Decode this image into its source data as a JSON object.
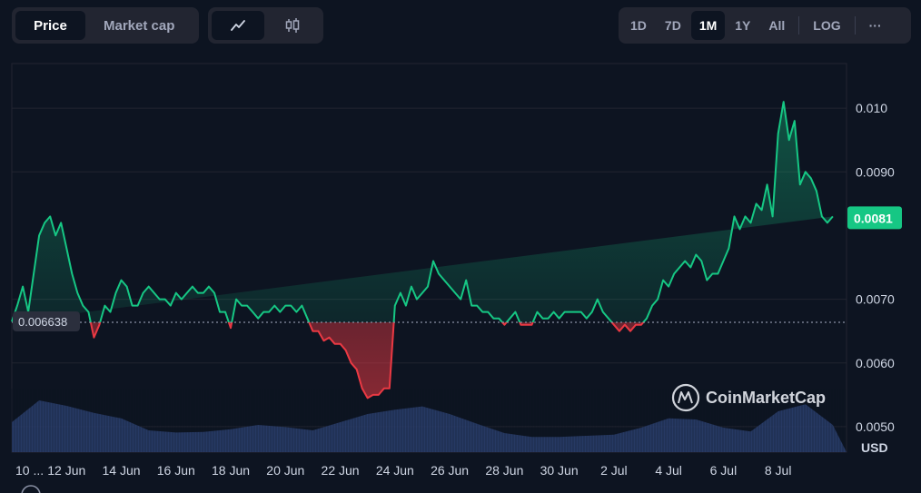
{
  "toolbar": {
    "type_tabs": [
      {
        "label": "Price",
        "active": true
      },
      {
        "label": "Market cap",
        "active": false
      }
    ],
    "style_tabs": [
      {
        "icon": "line-chart-icon",
        "active": true
      },
      {
        "icon": "candlestick-icon",
        "active": false
      }
    ],
    "range_tabs": [
      {
        "label": "1D",
        "active": false
      },
      {
        "label": "7D",
        "active": false
      },
      {
        "label": "1M",
        "active": true
      },
      {
        "label": "1Y",
        "active": false
      },
      {
        "label": "All",
        "active": false
      },
      {
        "label": "LOG",
        "active": false
      }
    ],
    "more_label": "···"
  },
  "watermark": "CoinMarketCap",
  "colors": {
    "background": "#0d1421",
    "up": "#16c784",
    "down": "#ea3943",
    "volume": "#2c3f6e",
    "grid": "#222531",
    "current_label_bg": "#16c784"
  },
  "chart_data": {
    "type": "area",
    "title": "",
    "xlabel": "",
    "ylabel": "",
    "currency_label": "USD",
    "baseline_label": "0.006638",
    "current_label": "0.0081",
    "baseline": 0.006638,
    "ylim": [
      0.0046,
      0.0107
    ],
    "y_ticks": [
      {
        "value": 0.005,
        "label": "0.0050"
      },
      {
        "value": 0.006,
        "label": "0.0060"
      },
      {
        "value": 0.007,
        "label": "0.0070"
      },
      {
        "value": 0.009,
        "label": "0.0090"
      },
      {
        "value": 0.01,
        "label": "0.010"
      }
    ],
    "x_range": [
      10,
      40.5
    ],
    "x_ticks": [
      {
        "day": 10.0,
        "label": "10 ..."
      },
      {
        "day": 12.0,
        "label": "12 Jun"
      },
      {
        "day": 14.0,
        "label": "14 Jun"
      },
      {
        "day": 16.0,
        "label": "16 Jun"
      },
      {
        "day": 18.0,
        "label": "18 Jun"
      },
      {
        "day": 20.0,
        "label": "20 Jun"
      },
      {
        "day": 22.0,
        "label": "22 Jun"
      },
      {
        "day": 24.0,
        "label": "24 Jun"
      },
      {
        "day": 26.0,
        "label": "26 Jun"
      },
      {
        "day": 28.0,
        "label": "28 Jun"
      },
      {
        "day": 30.0,
        "label": "30 Jun"
      },
      {
        "day": 32.0,
        "label": "2 Jul"
      },
      {
        "day": 34.0,
        "label": "4 Jul"
      },
      {
        "day": 36.0,
        "label": "6 Jul"
      },
      {
        "day": 38.0,
        "label": "8 Jul"
      }
    ],
    "price_series": {
      "x": [
        10.0,
        10.2,
        10.4,
        10.6,
        10.8,
        11.0,
        11.2,
        11.4,
        11.6,
        11.8,
        12.0,
        12.2,
        12.4,
        12.6,
        12.8,
        13.0,
        13.2,
        13.4,
        13.6,
        13.8,
        14.0,
        14.2,
        14.4,
        14.6,
        14.8,
        15.0,
        15.2,
        15.4,
        15.6,
        15.8,
        16.0,
        16.2,
        16.4,
        16.6,
        16.8,
        17.0,
        17.2,
        17.4,
        17.6,
        17.8,
        18.0,
        18.2,
        18.4,
        18.6,
        18.8,
        19.0,
        19.2,
        19.4,
        19.6,
        19.8,
        20.0,
        20.2,
        20.4,
        20.6,
        20.8,
        21.0,
        21.2,
        21.4,
        21.6,
        21.8,
        22.0,
        22.2,
        22.4,
        22.6,
        22.8,
        23.0,
        23.2,
        23.4,
        23.6,
        23.8,
        24.0,
        24.2,
        24.4,
        24.6,
        24.8,
        25.0,
        25.2,
        25.4,
        25.6,
        25.8,
        26.0,
        26.2,
        26.4,
        26.6,
        26.8,
        27.0,
        27.2,
        27.4,
        27.6,
        27.8,
        28.0,
        28.2,
        28.4,
        28.6,
        28.8,
        29.0,
        29.2,
        29.4,
        29.6,
        29.8,
        30.0,
        30.2,
        30.4,
        30.6,
        30.8,
        31.0,
        31.2,
        31.4,
        31.6,
        31.8,
        32.0,
        32.2,
        32.4,
        32.6,
        32.8,
        33.0,
        33.2,
        33.4,
        33.6,
        33.8,
        34.0,
        34.2,
        34.4,
        34.6,
        34.8,
        35.0,
        35.2,
        35.4,
        35.6,
        35.8,
        36.0,
        36.2,
        36.4,
        36.6,
        36.8,
        37.0,
        37.2,
        37.4,
        37.6,
        37.8,
        38.0,
        38.2,
        38.4,
        38.6,
        38.8,
        39.0,
        39.2,
        39.4,
        39.6,
        39.8,
        40.0,
        40.2,
        40.4
      ],
      "y": [
        0.00665,
        0.0069,
        0.0072,
        0.0068,
        0.0074,
        0.008,
        0.0082,
        0.0083,
        0.008,
        0.0082,
        0.0078,
        0.0074,
        0.0071,
        0.0069,
        0.0068,
        0.0064,
        0.0066,
        0.0069,
        0.0068,
        0.0071,
        0.0073,
        0.0072,
        0.0069,
        0.0069,
        0.0071,
        0.0072,
        0.0071,
        0.007,
        0.007,
        0.0069,
        0.0071,
        0.007,
        0.0071,
        0.0072,
        0.0071,
        0.0071,
        0.0072,
        0.0071,
        0.0068,
        0.0068,
        0.00655,
        0.007,
        0.0069,
        0.0069,
        0.0068,
        0.0067,
        0.0068,
        0.0068,
        0.0069,
        0.0068,
        0.0069,
        0.0069,
        0.0068,
        0.0069,
        0.0067,
        0.0065,
        0.0065,
        0.00635,
        0.0064,
        0.0063,
        0.0063,
        0.0062,
        0.006,
        0.0059,
        0.0056,
        0.00545,
        0.0055,
        0.0055,
        0.0056,
        0.0056,
        0.0069,
        0.0071,
        0.0069,
        0.0072,
        0.007,
        0.0071,
        0.0072,
        0.0076,
        0.0074,
        0.0073,
        0.0072,
        0.0071,
        0.007,
        0.0073,
        0.0069,
        0.0069,
        0.0068,
        0.0068,
        0.0067,
        0.0067,
        0.0066,
        0.0067,
        0.0068,
        0.0066,
        0.0066,
        0.0066,
        0.0068,
        0.0067,
        0.0067,
        0.0068,
        0.0067,
        0.0068,
        0.0068,
        0.0068,
        0.0068,
        0.0067,
        0.0068,
        0.007,
        0.0068,
        0.0067,
        0.0066,
        0.0065,
        0.0066,
        0.0065,
        0.0066,
        0.0066,
        0.0067,
        0.0069,
        0.007,
        0.0073,
        0.0072,
        0.0074,
        0.0075,
        0.0076,
        0.0075,
        0.0077,
        0.0076,
        0.0073,
        0.0074,
        0.0074,
        0.0076,
        0.0078,
        0.0083,
        0.0081,
        0.0083,
        0.0082,
        0.0085,
        0.0084,
        0.0088,
        0.0083,
        0.0096,
        0.0101,
        0.0095,
        0.0098,
        0.0088,
        0.009,
        0.0089,
        0.0087,
        0.0083,
        0.0082,
        0.0083
      ]
    },
    "volume_series": {
      "note_units": "relative",
      "x": [
        10,
        11,
        12,
        13,
        14,
        15,
        16,
        17,
        18,
        19,
        20,
        21,
        22,
        23,
        24,
        25,
        26,
        27,
        28,
        29,
        30,
        31,
        32,
        33,
        34,
        35,
        36,
        37,
        38,
        39,
        40
      ],
      "values": [
        0.55,
        0.95,
        0.85,
        0.72,
        0.62,
        0.4,
        0.36,
        0.37,
        0.42,
        0.5,
        0.46,
        0.4,
        0.55,
        0.7,
        0.78,
        0.84,
        0.7,
        0.52,
        0.35,
        0.28,
        0.28,
        0.3,
        0.32,
        0.45,
        0.62,
        0.6,
        0.45,
        0.38,
        0.75,
        0.88,
        0.5
      ]
    }
  }
}
